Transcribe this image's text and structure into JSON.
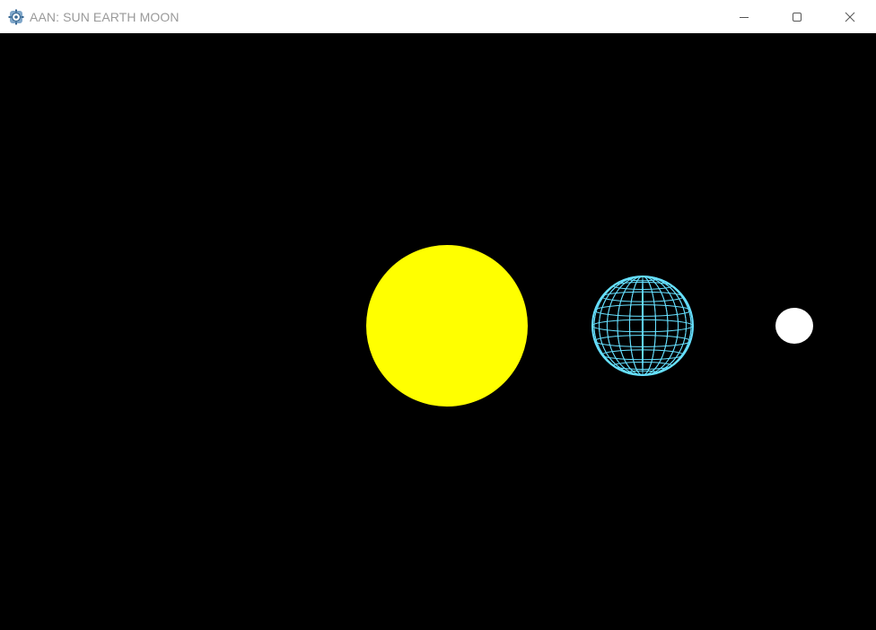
{
  "window": {
    "title": "AAN: SUN EARTH MOON",
    "icon": "app-icon"
  },
  "controls": {
    "minimize_icon": "minimize-icon",
    "maximize_icon": "maximize-icon",
    "close_icon": "close-icon"
  },
  "scene": {
    "background": "#000000",
    "sun": {
      "color": "#ffff00",
      "style": "solid"
    },
    "earth": {
      "color": "#66e0ff",
      "style": "wireframe"
    },
    "moon": {
      "color": "#ffffff",
      "style": "solid"
    }
  }
}
